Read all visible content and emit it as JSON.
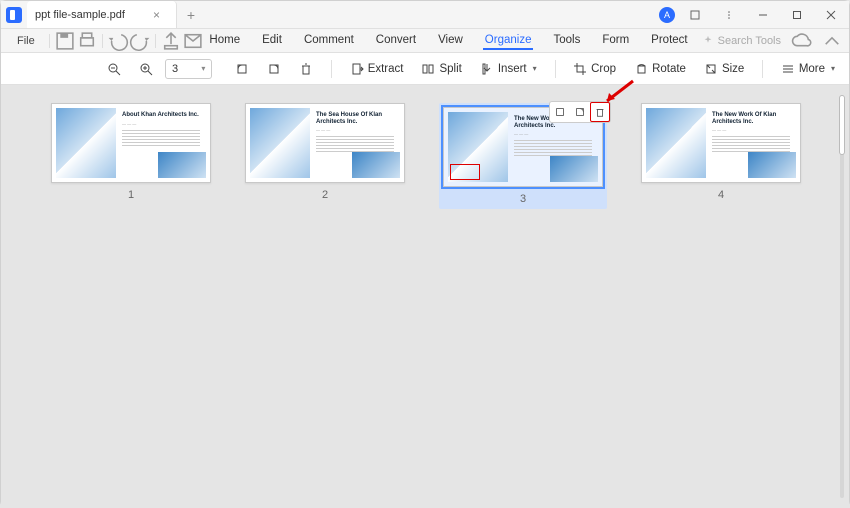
{
  "titlebar": {
    "filename": "ppt file-sample.pdf",
    "avatar_initial": "A"
  },
  "quickbar": {
    "file_label": "File",
    "menu": [
      "Home",
      "Edit",
      "Comment",
      "Convert",
      "View",
      "Organize",
      "Tools",
      "Form",
      "Protect"
    ],
    "active_menu_index": 5,
    "search_placeholder": "Search Tools"
  },
  "toolbar": {
    "page_value": "3",
    "extract": "Extract",
    "split": "Split",
    "insert": "Insert",
    "crop": "Crop",
    "rotate": "Rotate",
    "size": "Size",
    "more": "More"
  },
  "thumbs": [
    {
      "num": "1",
      "title": "About Khan Architects Inc.",
      "selected": false,
      "redbox": false
    },
    {
      "num": "2",
      "title": "The Sea House Of Klan Architects Inc.",
      "selected": false,
      "redbox": false
    },
    {
      "num": "3",
      "title": "The New Work Of Klan Architects Inc.",
      "selected": true,
      "redbox": true
    },
    {
      "num": "4",
      "title": "The New Work Of Klan Architects Inc.",
      "selected": false,
      "redbox": false
    }
  ],
  "mini_toolbar": {
    "items": [
      "rotate-left",
      "rotate-right",
      "delete"
    ],
    "highlight_index": 2
  }
}
